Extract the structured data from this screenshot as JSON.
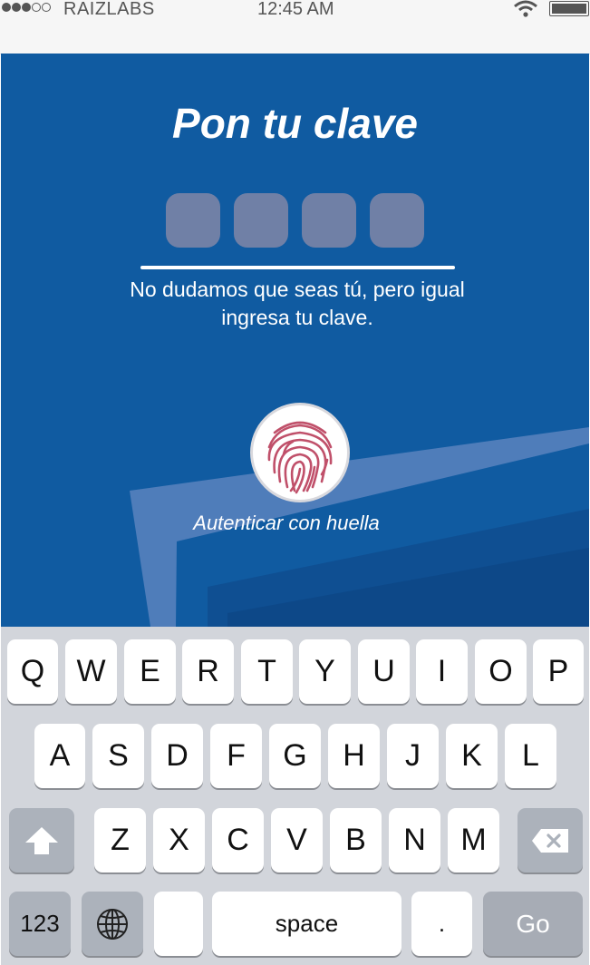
{
  "status_bar": {
    "carrier": "RAIZLABS",
    "time": "12:45 AM",
    "signal_dots_filled": 3,
    "signal_dots_total": 5,
    "icons": [
      "signal-dots-icon",
      "wifi-icon",
      "battery-icon"
    ]
  },
  "screen": {
    "title": "Pon tu clave",
    "pin_length": 4,
    "hint": "No dudamos que seas tú, pero igual ingresa tu clave.",
    "fingerprint_label": "Autenticar con huella",
    "fingerprint_icon": "fingerprint-icon"
  },
  "keyboard": {
    "row1": [
      "Q",
      "W",
      "E",
      "R",
      "T",
      "Y",
      "U",
      "I",
      "O",
      "P"
    ],
    "row2": [
      "A",
      "S",
      "D",
      "F",
      "G",
      "H",
      "J",
      "K",
      "L"
    ],
    "row3": [
      "Z",
      "X",
      "C",
      "V",
      "B",
      "N",
      "M"
    ],
    "shift_icon": "shift-arrow-icon",
    "delete_icon": "backspace-icon",
    "numbers_label": "123",
    "globe_icon": "globe-icon",
    "space_label": "space",
    "period_label": ".",
    "go_label": "Go"
  },
  "colors": {
    "primary_blue": "#105ba1",
    "pin_box": "#7080a6",
    "fingerprint": "#c0506a",
    "keyboard_bg": "#d2d5db"
  }
}
